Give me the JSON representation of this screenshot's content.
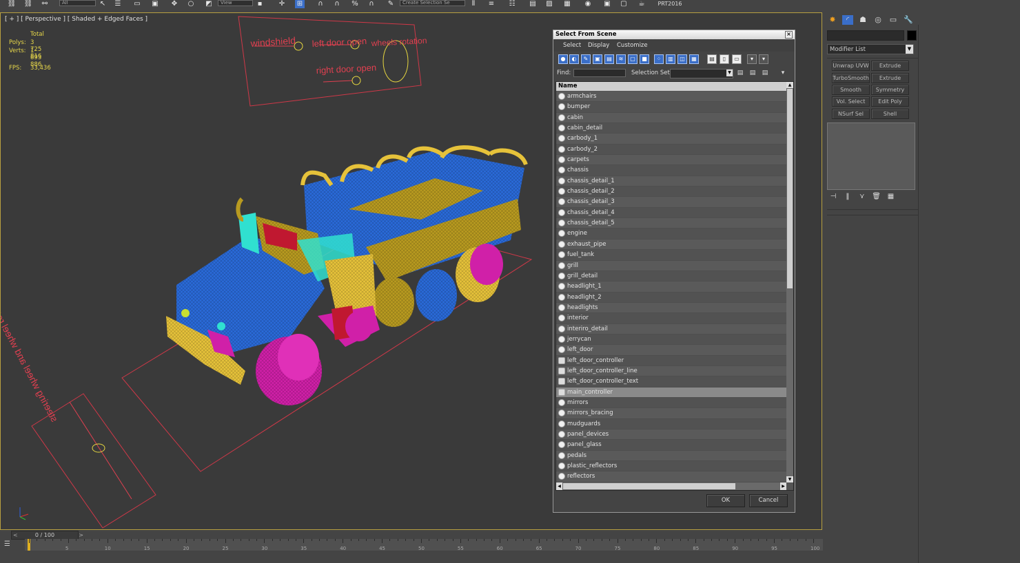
{
  "app": {
    "toolbar": {
      "named_selection_dropdown": "All",
      "reference_coord_dropdown": "View",
      "create_selection_set": "Create Selection Se",
      "version_label": "PRT2016"
    }
  },
  "viewport": {
    "label": "[ + ] [ Perspective ] [ Shaded + Edged Faces ]",
    "stats": {
      "total_header": "Total",
      "polys_label": "Polys:",
      "polys_value": "3 725 816",
      "verts_label": "Verts:",
      "verts_value": "1 893 886",
      "fps_label": "FPS:",
      "fps_value": "33,436"
    },
    "controller_labels": {
      "windshield": "windshield",
      "left_door_open": "left door open",
      "wheels_rotation": "wheels rotation",
      "right_door_open": "right door open",
      "steering_wheel_and_wheels_rotation": "steering wheel and wheel rotation"
    },
    "colors": {
      "wire_blue": "#2a6ad8",
      "wire_yellow": "#e6c23a",
      "wire_magenta": "#e020b0",
      "wire_cyan": "#30e0d0",
      "wire_olive": "#b89a20",
      "wire_red": "#c01830",
      "controller_red": "#e04050",
      "controller_yellow": "#e8d840"
    }
  },
  "command_panel": {
    "modifier_list": "Modifier List",
    "buttons": [
      [
        "Unwrap UVW",
        "Extrude"
      ],
      [
        "TurboSmooth",
        "Extrude"
      ],
      [
        "Smooth",
        "Symmetry"
      ],
      [
        "Vol. Select",
        "Edit Poly"
      ],
      [
        "NSurf Sel",
        "Shell"
      ]
    ]
  },
  "dialog": {
    "title": "Select From Scene",
    "menu": [
      "Select",
      "Display",
      "Customize"
    ],
    "find_label": "Find:",
    "find_value": "",
    "selection_set_label": "Selection Set:",
    "column_name": "Name",
    "ok": "OK",
    "cancel": "Cancel",
    "selected_item": "main_controller",
    "items": [
      {
        "name": "armchairs",
        "type": "geometry"
      },
      {
        "name": "bumper",
        "type": "geometry"
      },
      {
        "name": "cabin",
        "type": "geometry"
      },
      {
        "name": "cabin_detail",
        "type": "geometry"
      },
      {
        "name": "carbody_1",
        "type": "geometry"
      },
      {
        "name": "carbody_2",
        "type": "geometry"
      },
      {
        "name": "carpets",
        "type": "geometry"
      },
      {
        "name": "chassis",
        "type": "geometry"
      },
      {
        "name": "chassis_detail_1",
        "type": "geometry"
      },
      {
        "name": "chassis_detail_2",
        "type": "geometry"
      },
      {
        "name": "chassis_detail_3",
        "type": "geometry"
      },
      {
        "name": "chassis_detail_4",
        "type": "geometry"
      },
      {
        "name": "chassis_detail_5",
        "type": "geometry"
      },
      {
        "name": "engine",
        "type": "geometry"
      },
      {
        "name": "exhaust_pipe",
        "type": "geometry"
      },
      {
        "name": "fuel_tank",
        "type": "geometry"
      },
      {
        "name": "grill",
        "type": "geometry"
      },
      {
        "name": "grill_detail",
        "type": "geometry"
      },
      {
        "name": "headlight_1",
        "type": "geometry"
      },
      {
        "name": "headlight_2",
        "type": "geometry"
      },
      {
        "name": "headlights",
        "type": "geometry"
      },
      {
        "name": "interior",
        "type": "geometry"
      },
      {
        "name": "interiro_detail",
        "type": "geometry"
      },
      {
        "name": "jerrycan",
        "type": "geometry"
      },
      {
        "name": "left_door",
        "type": "geometry"
      },
      {
        "name": "left_door_controller",
        "type": "shape"
      },
      {
        "name": "left_door_controller_line",
        "type": "shape"
      },
      {
        "name": "left_door_controller_text",
        "type": "shape"
      },
      {
        "name": "main_controller",
        "type": "shape"
      },
      {
        "name": "mirrors",
        "type": "geometry"
      },
      {
        "name": "mirrors_bracing",
        "type": "geometry"
      },
      {
        "name": "mudguards",
        "type": "geometry"
      },
      {
        "name": "panel_devices",
        "type": "geometry"
      },
      {
        "name": "panel_glass",
        "type": "geometry"
      },
      {
        "name": "pedals",
        "type": "geometry"
      },
      {
        "name": "plastic_reflectors",
        "type": "geometry"
      },
      {
        "name": "reflectors",
        "type": "geometry"
      }
    ]
  },
  "timeline": {
    "frame_counter": "0 / 100",
    "ticks": [
      "5",
      "10",
      "15",
      "20",
      "25",
      "30",
      "35",
      "40",
      "45",
      "50",
      "55",
      "60",
      "65",
      "70",
      "75",
      "80",
      "85",
      "90",
      "95",
      "100"
    ]
  }
}
